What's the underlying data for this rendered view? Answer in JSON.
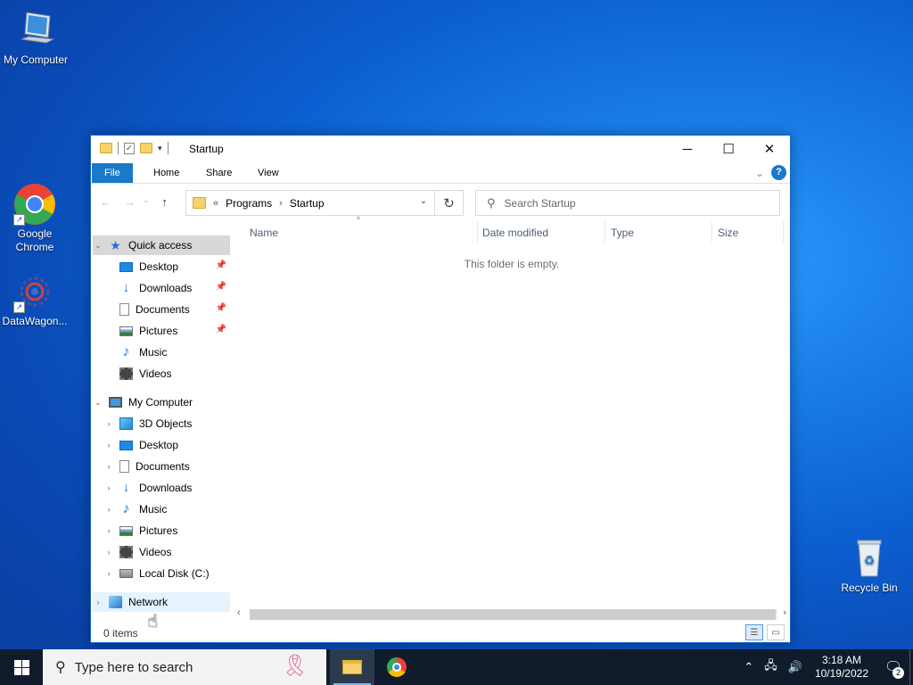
{
  "desktop": {
    "icons": [
      {
        "label": "My Computer",
        "icon": "monitor-icon"
      },
      {
        "label": "Google\nChrome",
        "icon": "chrome-icon"
      },
      {
        "label": "DataWagon...",
        "icon": "gear-app-icon"
      },
      {
        "label": "Recycle Bin",
        "icon": "recycle-bin-icon"
      }
    ]
  },
  "window": {
    "title": "Startup",
    "ribbon_tabs": [
      "File",
      "Home",
      "Share",
      "View"
    ],
    "address": {
      "prefix": "«",
      "crumbs": [
        "Programs",
        "Startup"
      ]
    },
    "search": {
      "placeholder": "Search Startup"
    },
    "sidebar": {
      "quick_access": {
        "label": "Quick access",
        "items": [
          {
            "label": "Desktop",
            "icon": "desktop-icon",
            "pinned": true
          },
          {
            "label": "Downloads",
            "icon": "download-icon",
            "pinned": true
          },
          {
            "label": "Documents",
            "icon": "document-icon",
            "pinned": true
          },
          {
            "label": "Pictures",
            "icon": "picture-icon",
            "pinned": true
          },
          {
            "label": "Music",
            "icon": "music-icon",
            "pinned": false
          },
          {
            "label": "Videos",
            "icon": "video-icon",
            "pinned": false
          }
        ]
      },
      "this_pc": {
        "label": "My Computer",
        "items": [
          {
            "label": "3D Objects",
            "icon": "cube-icon"
          },
          {
            "label": "Desktop",
            "icon": "desktop-icon"
          },
          {
            "label": "Documents",
            "icon": "document-icon"
          },
          {
            "label": "Downloads",
            "icon": "download-icon"
          },
          {
            "label": "Music",
            "icon": "music-icon"
          },
          {
            "label": "Pictures",
            "icon": "picture-icon"
          },
          {
            "label": "Videos",
            "icon": "video-icon"
          },
          {
            "label": "Local Disk (C:)",
            "icon": "disk-icon"
          }
        ]
      },
      "network": {
        "label": "Network"
      }
    },
    "columns": [
      "Name",
      "Date modified",
      "Type",
      "Size"
    ],
    "empty_message": "This folder is empty.",
    "status": {
      "item_count": "0 items"
    }
  },
  "taskbar": {
    "search_placeholder": "Type here to search",
    "apps": [
      {
        "name": "File Explorer",
        "icon": "folder-icon",
        "active": true
      },
      {
        "name": "Google Chrome",
        "icon": "chrome-icon",
        "active": false
      }
    ],
    "clock": {
      "time": "3:18 AM",
      "date": "10/19/2022"
    },
    "notification_count": "2"
  },
  "colors": {
    "accent": "#1979ca",
    "taskbar": "#101c2c",
    "desktop": "#0c5fd0"
  }
}
